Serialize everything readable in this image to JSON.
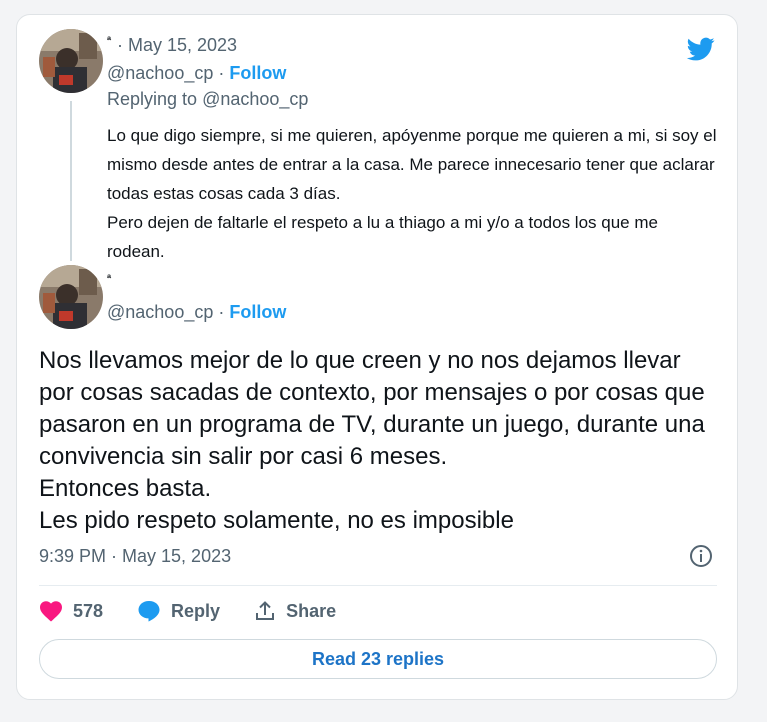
{
  "colors": {
    "accent": "#1d9bf0",
    "like": "#f91880",
    "muted": "#536471",
    "text": "#0f1419"
  },
  "header_icon": "twitter-bird-icon",
  "reply_tweet": {
    "name": "ª",
    "date": "· May 15, 2023",
    "handle": "@nachoo_cp",
    "sep": "·",
    "follow_label": "Follow",
    "replying_prefix": "Replying to ",
    "replying_handle": "@nachoo_cp",
    "text_lines": [
      "Lo que digo siempre, si me quieren, apóyenme porque me quieren a mi, si soy el mismo desde antes de entrar a la casa. Me parece innecesario tener que aclarar todas estas cosas cada 3 días.",
      "Pero dejen de faltarle el respeto a lu a thiago a mi y/o a todos los que me rodean."
    ]
  },
  "main_tweet": {
    "name": "ª",
    "handle": "@nachoo_cp",
    "sep": "·",
    "follow_label": "Follow",
    "text_lines": [
      "Nos llevamos mejor de lo que creen y no nos dejamos llevar por cosas sacadas de contexto, por mensajes o por cosas que pasaron en un programa de TV, durante un juego, durante una convivencia sin salir por casi 6 meses.",
      "Entonces basta.",
      "Les pido respeto solamente, no es imposible"
    ],
    "timestamp": "9:39 PM · May 15, 2023",
    "info_icon": "info-icon"
  },
  "actions": {
    "like_count": "578",
    "reply_label": "Reply",
    "share_label": "Share"
  },
  "read_replies_label": "Read 23 replies"
}
